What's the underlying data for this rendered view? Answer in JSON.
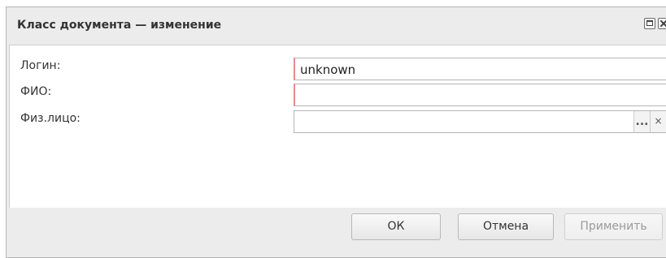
{
  "dialog": {
    "title": "Класс документа — изменение",
    "controls": [
      "maximize-icon",
      "close-icon"
    ]
  },
  "form": {
    "login": {
      "label": "Логин:",
      "value": "unknown",
      "required": true
    },
    "fio": {
      "label": "ФИО:",
      "value": "",
      "required": true
    },
    "person": {
      "label": "Физ.лицо:",
      "value": "",
      "browse_label": "...",
      "clear_label": "×"
    }
  },
  "buttons": {
    "ok": "ОК",
    "cancel": "Отмена",
    "apply": "Применить"
  },
  "colors": {
    "required_marker": "#e8898f",
    "dialog_background": "#ececec"
  }
}
